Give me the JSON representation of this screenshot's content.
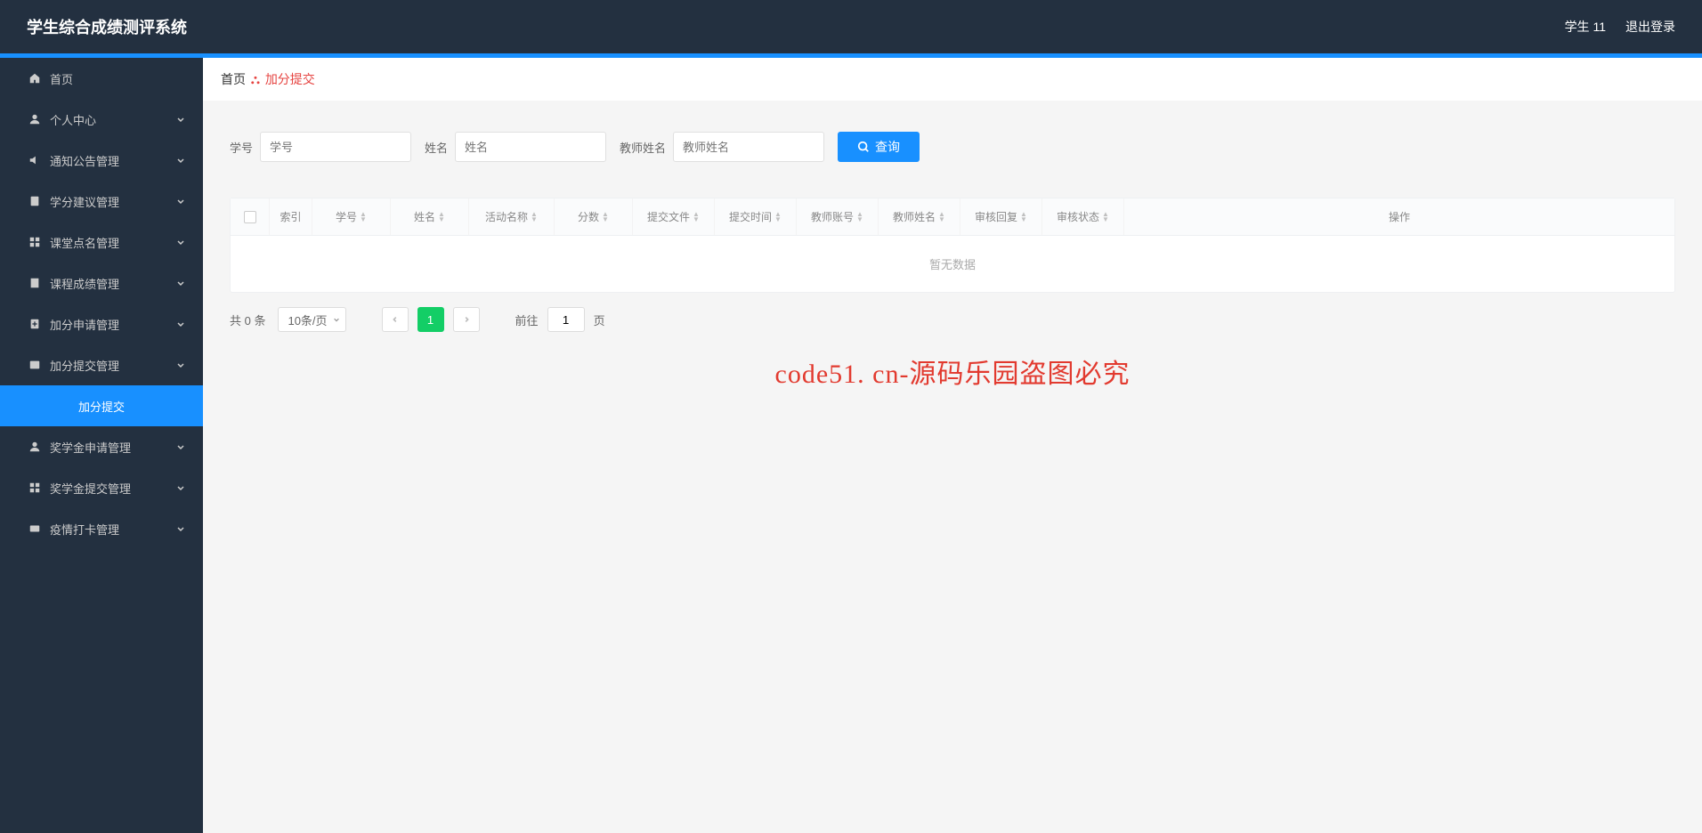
{
  "header": {
    "title": "学生综合成绩测评系统",
    "user": "学生 11",
    "logout": "退出登录"
  },
  "sidebar": [
    {
      "label": "首页",
      "icon": "home",
      "expandable": false
    },
    {
      "label": "个人中心",
      "icon": "user",
      "expandable": true
    },
    {
      "label": "通知公告管理",
      "icon": "speaker",
      "expandable": true
    },
    {
      "label": "学分建议管理",
      "icon": "clipboard",
      "expandable": true
    },
    {
      "label": "课堂点名管理",
      "icon": "grid",
      "expandable": true
    },
    {
      "label": "课程成绩管理",
      "icon": "book",
      "expandable": true
    },
    {
      "label": "加分申请管理",
      "icon": "plus-doc",
      "expandable": true
    },
    {
      "label": "加分提交管理",
      "icon": "submit",
      "expandable": true
    },
    {
      "label": "加分提交",
      "icon": "",
      "expandable": false,
      "active": true
    },
    {
      "label": "奖学金申请管理",
      "icon": "award-user",
      "expandable": true
    },
    {
      "label": "奖学金提交管理",
      "icon": "award-grid",
      "expandable": true
    },
    {
      "label": "疫情打卡管理",
      "icon": "card",
      "expandable": true
    }
  ],
  "breadcrumb": {
    "home": "首页",
    "cur": "加分提交"
  },
  "search": {
    "f1_label": "学号",
    "f1_ph": "学号",
    "f2_label": "姓名",
    "f2_ph": "姓名",
    "f3_label": "教师姓名",
    "f3_ph": "教师姓名",
    "query": "查询"
  },
  "table": {
    "cols": {
      "index": "索引",
      "num": "学号",
      "name": "姓名",
      "act": "活动名称",
      "score": "分数",
      "file": "提交文件",
      "time": "提交时间",
      "tacc": "教师账号",
      "tname": "教师姓名",
      "reply": "审核回复",
      "status": "审核状态",
      "ops": "操作"
    },
    "empty": "暂无数据"
  },
  "pager": {
    "total": "共 0 条",
    "size": "10条/页",
    "page": "1",
    "jump_label": "前往",
    "jump_value": "1",
    "jump_suffix": "页"
  },
  "watermark_text": "code51.cn",
  "overlay_text": "code51. cn-源码乐园盗图必究"
}
